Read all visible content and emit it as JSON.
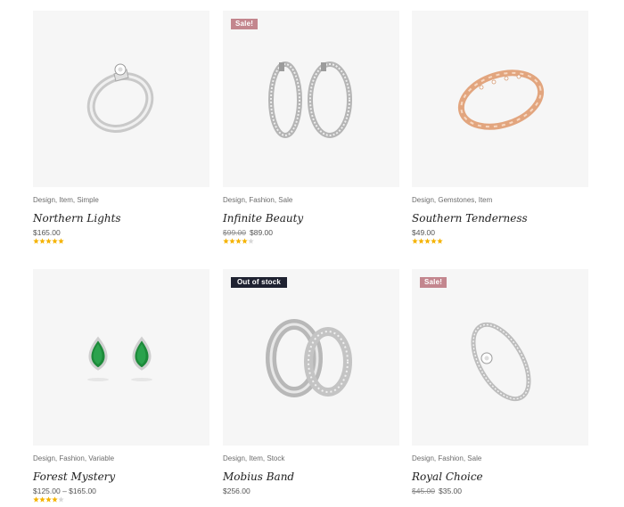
{
  "colors": {
    "accent_sale": "#c3868e",
    "badge_dark": "#1f2231",
    "star_filled": "#f5b301",
    "star_empty": "#d8d8d8",
    "thumb_bg": "#f6f6f6"
  },
  "products": [
    {
      "categories": [
        "Design",
        "Item",
        "Simple"
      ],
      "title": "Northern Lights",
      "price": "$165.00",
      "old_price": "",
      "badge": "",
      "rating": 5,
      "image": "silver-diamond-ring"
    },
    {
      "categories": [
        "Design",
        "Fashion",
        "Sale"
      ],
      "title": "Infinite Beauty",
      "price": "$89.00",
      "old_price": "$99.00",
      "badge": "Sale!",
      "rating": 4,
      "image": "silver-hoop-earrings"
    },
    {
      "categories": [
        "Design",
        "Gemstones",
        "Item"
      ],
      "title": "Southern Tenderness",
      "price": "$49.00",
      "old_price": "",
      "badge": "",
      "rating": 5,
      "image": "rose-gold-ring"
    },
    {
      "categories": [
        "Design",
        "Fashion",
        "Variable"
      ],
      "title": "Forest Mystery",
      "price": "$125.00 – $165.00",
      "old_price": "",
      "badge": "",
      "rating": 4,
      "image": "emerald-earrings"
    },
    {
      "categories": [
        "Design",
        "Item",
        "Stock"
      ],
      "title": "Mobius Band",
      "price": "$256.00",
      "old_price": "",
      "badge": "Out of stock",
      "rating": 0,
      "image": "wedding-bands"
    },
    {
      "categories": [
        "Design",
        "Fashion",
        "Sale"
      ],
      "title": "Royal Choice",
      "price": "$35.00",
      "old_price": "$45.00",
      "badge": "Sale!",
      "rating": 0,
      "image": "diamond-engagement-ring"
    }
  ]
}
